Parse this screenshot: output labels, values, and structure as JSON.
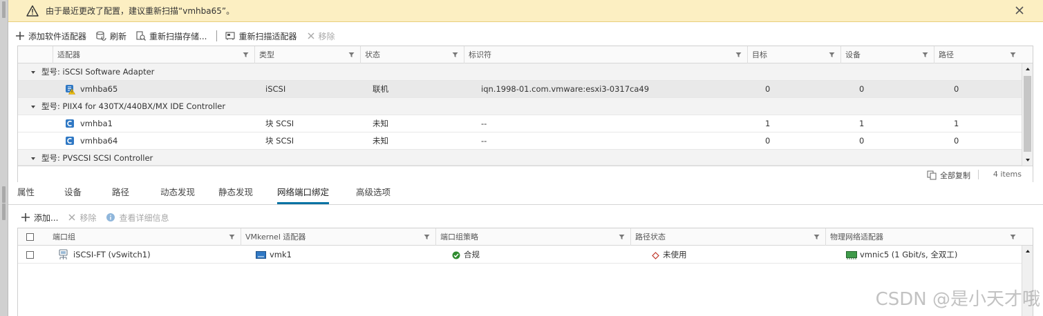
{
  "banner": {
    "message": "由于最近更改了配置，建议重新扫描“vmhba65”。",
    "warning_color": "#fcefc2"
  },
  "toolbar": {
    "add_adapter": "添加软件适配器",
    "refresh": "刷新",
    "rescan_storage": "重新扫描存储...",
    "rescan_adapter": "重新扫描适配器",
    "remove": "移除"
  },
  "adapters_grid": {
    "columns": [
      "适配器",
      "类型",
      "状态",
      "标识符",
      "目标",
      "设备",
      "路径"
    ],
    "groups": [
      {
        "label": "型号: iSCSI Software Adapter",
        "rows": [
          {
            "name": "vmhba65",
            "type": "iSCSI",
            "status": "联机",
            "identifier": "iqn.1998-01.com.vmware:esxi3-0317ca49",
            "targets": "0",
            "devices": "0",
            "paths": "0"
          }
        ]
      },
      {
        "label": "型号: PIIX4 for 430TX/440BX/MX IDE Controller",
        "rows": [
          {
            "name": "vmhba1",
            "type": "块 SCSI",
            "status": "未知",
            "identifier": "--",
            "targets": "1",
            "devices": "1",
            "paths": "1"
          },
          {
            "name": "vmhba64",
            "type": "块 SCSI",
            "status": "未知",
            "identifier": "--",
            "targets": "0",
            "devices": "0",
            "paths": "0"
          }
        ]
      },
      {
        "label": "型号: PVSCSI SCSI Controller",
        "rows": []
      }
    ],
    "copy_all": "全部复制",
    "item_count": "4 items"
  },
  "tabs": [
    "属性",
    "设备",
    "路径",
    "动态发现",
    "静态发现",
    "网络端口绑定",
    "高级选项"
  ],
  "active_tab": "网络端口绑定",
  "toolbar2": {
    "add": "添加...",
    "remove": "移除",
    "details": "查看详细信息"
  },
  "binding_grid": {
    "columns": [
      "端口组",
      "VMkernel 适配器",
      "端口组策略",
      "路径状态",
      "物理网络适配器"
    ],
    "rows": [
      {
        "port_group": "iSCSI-FT (vSwitch1)",
        "vmkernel": "vmk1",
        "policy": "合规",
        "path_status": "未使用",
        "physical": "vmnic5 (1 Gbit/s, 全双工)"
      }
    ]
  },
  "watermark": "CSDN @是小天才哦",
  "colors": {
    "accent": "#0072a3",
    "ok": "#2e8b2e",
    "unused": "#c0392b"
  }
}
